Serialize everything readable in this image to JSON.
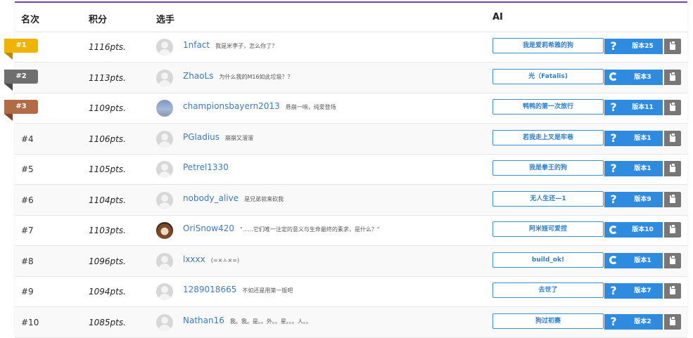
{
  "header": {
    "rank": "名次",
    "score": "积分",
    "player": "选手",
    "ai": "AI"
  },
  "rows": [
    {
      "rank": "#1",
      "flag_color": "#f0b400",
      "flag_dark": "#b98a00",
      "score": "1116pts.",
      "avatar": "default",
      "name": "1nfact",
      "motto": "我是米李子，怎么你了？",
      "ai_name": "我是爱莉希雅的狗",
      "ai_icon": "question-icon",
      "ai_version": "版本25"
    },
    {
      "rank": "#2",
      "flag_color": "#6f6f6f",
      "flag_dark": "#4a4a4a",
      "score": "1113pts.",
      "avatar": "default",
      "name": "ZhaoLs",
      "motto": "为什么我的M16如此垃圾？？",
      "ai_name": "光（Fatalis)",
      "ai_icon": "c-icon",
      "ai_version": "版本3"
    },
    {
      "rank": "#3",
      "flag_color": "#b06c44",
      "flag_dark": "#7d4526",
      "score": "1109pts.",
      "avatar": "sky",
      "name": "championsbayern2013",
      "motto": "悬崩一响，纯爱登场",
      "ai_name": "鸭鸭的第一次旅行",
      "ai_icon": "question-icon",
      "ai_version": "版本11"
    },
    {
      "rank": "#4",
      "score": "1106pts.",
      "avatar": "default",
      "name": "PGladius",
      "motto": "崩崩又溜溜",
      "ai_name": "若我走上叉是牢巷",
      "ai_icon": "question-icon",
      "ai_version": "版本1"
    },
    {
      "rank": "#5",
      "score": "1105pts.",
      "avatar": "default",
      "name": "Petrel1330",
      "motto": "",
      "ai_name": "我是拳王的狗",
      "ai_icon": "question-icon",
      "ai_version": "版本1"
    },
    {
      "rank": "#6",
      "score": "1104pts.",
      "avatar": "default",
      "name": "nobody_alive",
      "motto": "是兄弟就来砍我",
      "ai_name": "无人生还—1",
      "ai_icon": "question-icon",
      "ai_version": "版本9"
    },
    {
      "rank": "#7",
      "score": "1103pts.",
      "avatar": "anime",
      "name": "OriSnow420",
      "motto": "\"......它们唯一注定的意义与生命最终的素求，是什么？\"",
      "ai_name": "阿米娅可爱捏",
      "ai_icon": "c-icon",
      "ai_version": "版本10"
    },
    {
      "rank": "#8",
      "score": "1096pts.",
      "avatar": "default",
      "name": "lxxxx",
      "motto": "(=×ㅗ×=)",
      "ai_name": "build_ok!",
      "ai_icon": "c-icon",
      "ai_version": "版本1"
    },
    {
      "rank": "#9",
      "score": "1094pts.",
      "avatar": "default",
      "name": "1289018665",
      "motto": "不如还是用第一版吧",
      "ai_name": "去世了",
      "ai_icon": "question-icon",
      "ai_version": "版本7"
    },
    {
      "rank": "#10",
      "score": "1085pts.",
      "avatar": "default",
      "name": "Nathan16",
      "motto": "我。我。是。。外。。星。。。人。。",
      "ai_name": "狗过初赛",
      "ai_icon": "question-icon",
      "ai_version": "版本2"
    }
  ]
}
